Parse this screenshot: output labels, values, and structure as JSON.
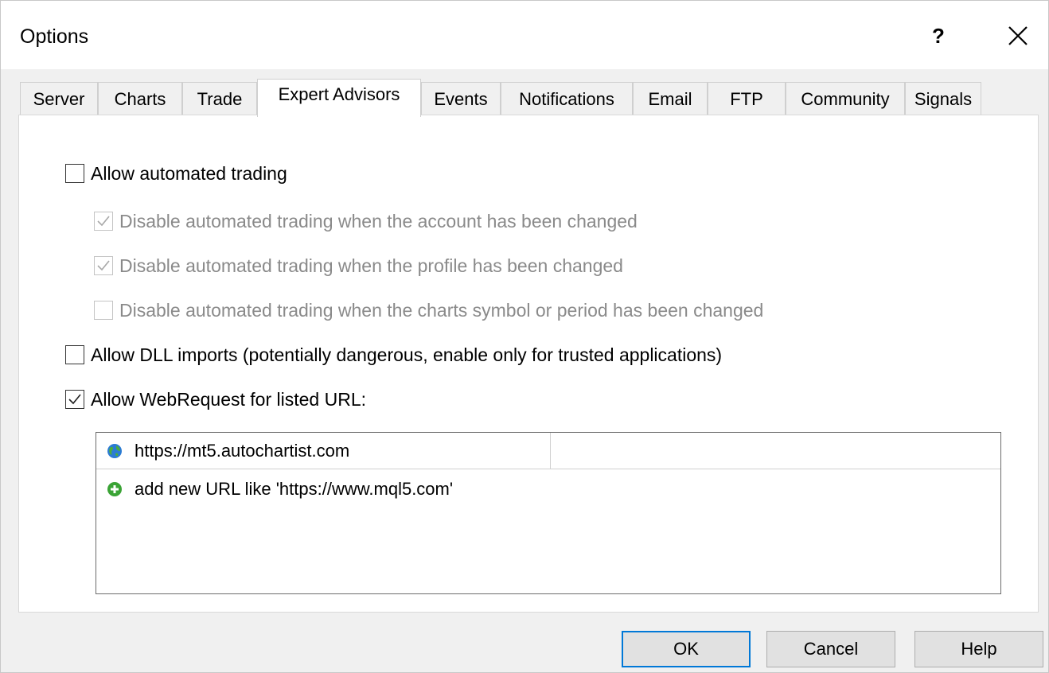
{
  "window": {
    "title": "Options",
    "help_glyph": "?"
  },
  "tabs": [
    {
      "label": "Server"
    },
    {
      "label": "Charts"
    },
    {
      "label": "Trade"
    },
    {
      "label": "Expert Advisors",
      "active": true
    },
    {
      "label": "Events"
    },
    {
      "label": "Notifications"
    },
    {
      "label": "Email"
    },
    {
      "label": "FTP"
    },
    {
      "label": "Community"
    },
    {
      "label": "Signals"
    }
  ],
  "options": {
    "allow_automated_trading": {
      "label": "Allow automated trading",
      "checked": false
    },
    "disable_account_changed": {
      "label": "Disable automated trading when the account has been changed",
      "checked": true,
      "enabled": false
    },
    "disable_profile_changed": {
      "label": "Disable automated trading when the profile has been changed",
      "checked": true,
      "enabled": false
    },
    "disable_symbol_changed": {
      "label": "Disable automated trading when the charts symbol or period has been changed",
      "checked": false,
      "enabled": false
    },
    "allow_dll_imports": {
      "label": "Allow DLL imports (potentially dangerous, enable only for trusted applications)",
      "checked": false
    },
    "allow_webrequest": {
      "label": "Allow WebRequest for listed URL:",
      "checked": true
    }
  },
  "url_list": {
    "items": [
      {
        "url": "https://mt5.autochartist.com",
        "icon": "globe-icon"
      }
    ],
    "add_placeholder": "add new URL like 'https://www.mql5.com'",
    "add_icon": "add-circle-icon"
  },
  "buttons": {
    "ok": "OK",
    "cancel": "Cancel",
    "help": "Help"
  },
  "colors": {
    "default_button_border": "#0078d7",
    "add_icon_green": "#3aa335",
    "globe_blue": "#2b7bd4"
  }
}
